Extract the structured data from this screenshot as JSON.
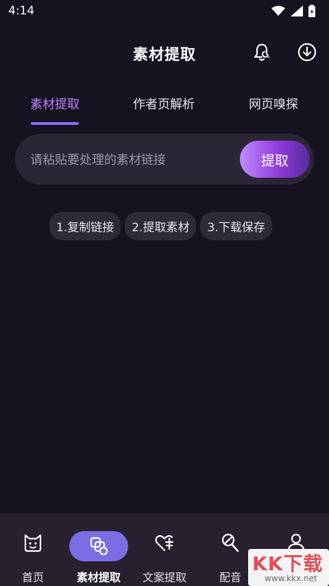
{
  "status": {
    "time": "4:14"
  },
  "header": {
    "title": "素材提取"
  },
  "tabs": [
    {
      "label": "素材提取",
      "active": true
    },
    {
      "label": "作者页解析",
      "active": false
    },
    {
      "label": "网页嗅探",
      "active": false
    }
  ],
  "search": {
    "placeholder": "请粘贴要处理的素材链接",
    "button_label": "提取"
  },
  "steps": [
    "1.复制链接",
    "2.提取素材",
    "3.下载保存"
  ],
  "bottom_nav": [
    {
      "label": "首页",
      "icon": "home-icon",
      "active": false
    },
    {
      "label": "素材提取",
      "icon": "material-extract-icon",
      "active": true
    },
    {
      "label": "文案提取",
      "icon": "copy-extract-icon",
      "active": false
    },
    {
      "label": "配音",
      "icon": "dubbing-icon",
      "active": false
    },
    {
      "label": "",
      "icon": "profile-icon",
      "active": false
    }
  ],
  "watermark": {
    "main": "KK下载",
    "sub": "www.kkx.net"
  },
  "colors": {
    "background": "#17121f",
    "accent": "#b489ff",
    "nav_pill": "#7b6de6",
    "button_gradient_start": "#c08bff",
    "button_gradient_end": "#5a2a9f"
  }
}
